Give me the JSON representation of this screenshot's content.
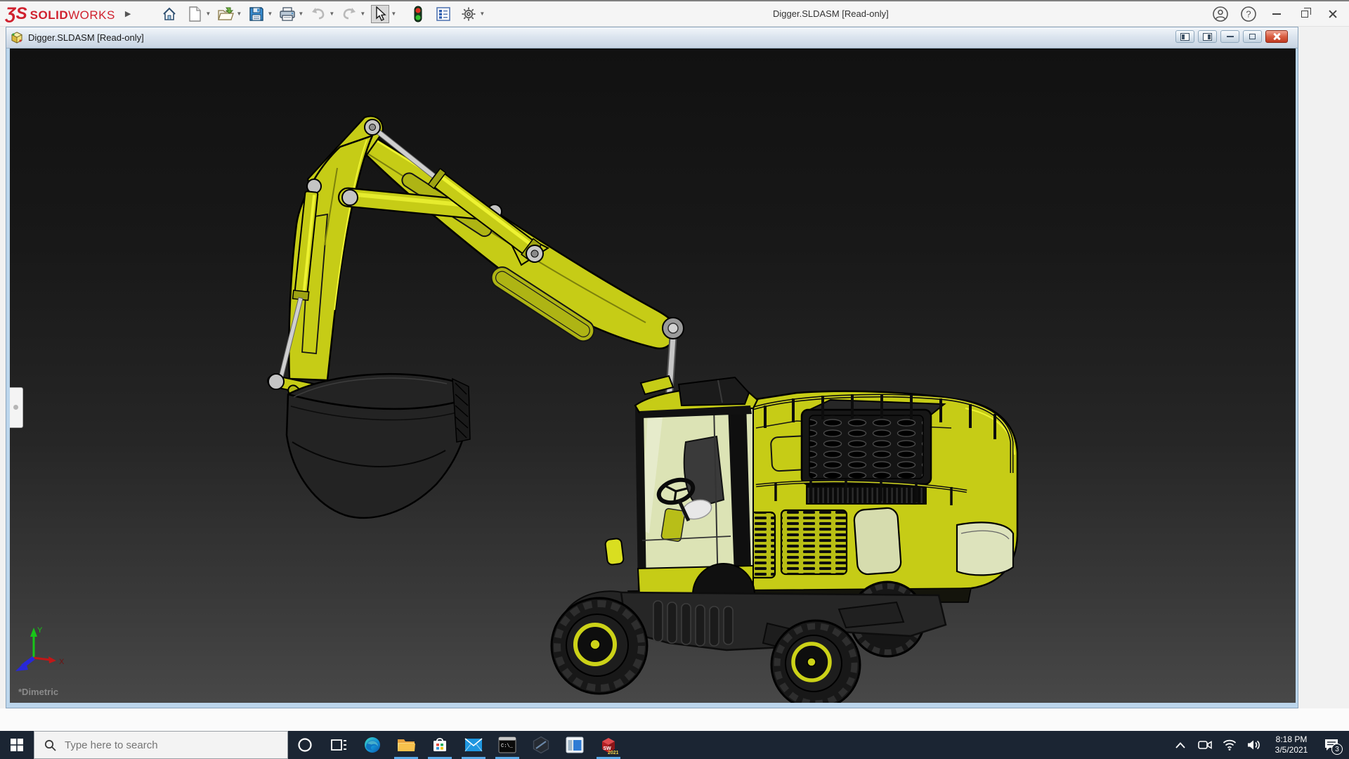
{
  "titlebar": {
    "brand": {
      "glyph": "ƷS",
      "solid": "SOLID",
      "works": "WORKS"
    },
    "title": "Digger.SLDASM [Read-only]",
    "toolbar_icons": [
      "home",
      "new-document",
      "open",
      "save",
      "print",
      "undo",
      "redo",
      "select",
      "rebuild",
      "file-properties",
      "options"
    ],
    "window_controls": [
      "account",
      "help",
      "minimize",
      "restore",
      "close"
    ]
  },
  "document_window": {
    "icon": "assembly-part-icon",
    "title": "Digger.SLDASM [Read-only]",
    "controls": [
      "split-pane-left",
      "split-pane-right",
      "minimize",
      "restore",
      "close"
    ],
    "viewport": {
      "model": "Digger excavator assembly",
      "view_label": "*Dimetric",
      "triad": {
        "x": "X",
        "y": "Y"
      }
    }
  },
  "taskbar": {
    "search": {
      "placeholder": "Type here to search"
    },
    "app_icons": [
      "cortana",
      "task-view",
      "edge",
      "file-explorer",
      "store",
      "mail",
      "command-prompt",
      "edrawings",
      "app-window",
      "solidworks-2021"
    ],
    "running_apps": [
      "file-explorer",
      "store",
      "mail",
      "command-prompt",
      "solidworks-2021"
    ],
    "cmd_text": "C:\\_",
    "sw_year": "2021",
    "tray": {
      "icons": [
        "chevron-up",
        "meet-now",
        "wifi",
        "volume",
        "action-center"
      ],
      "time": "8:18 PM",
      "date": "3/5/2021",
      "notification_count": "3"
    }
  },
  "colors": {
    "model_yellow": "#c6cc16",
    "model_highlight": "#eef332",
    "viewport_top": "#111111",
    "viewport_bottom": "#484848",
    "frame_blue": "#bcd6ec",
    "taskbar": "#1b2533",
    "close_red": "#bf3a22",
    "brand_red": "#d0212e"
  }
}
